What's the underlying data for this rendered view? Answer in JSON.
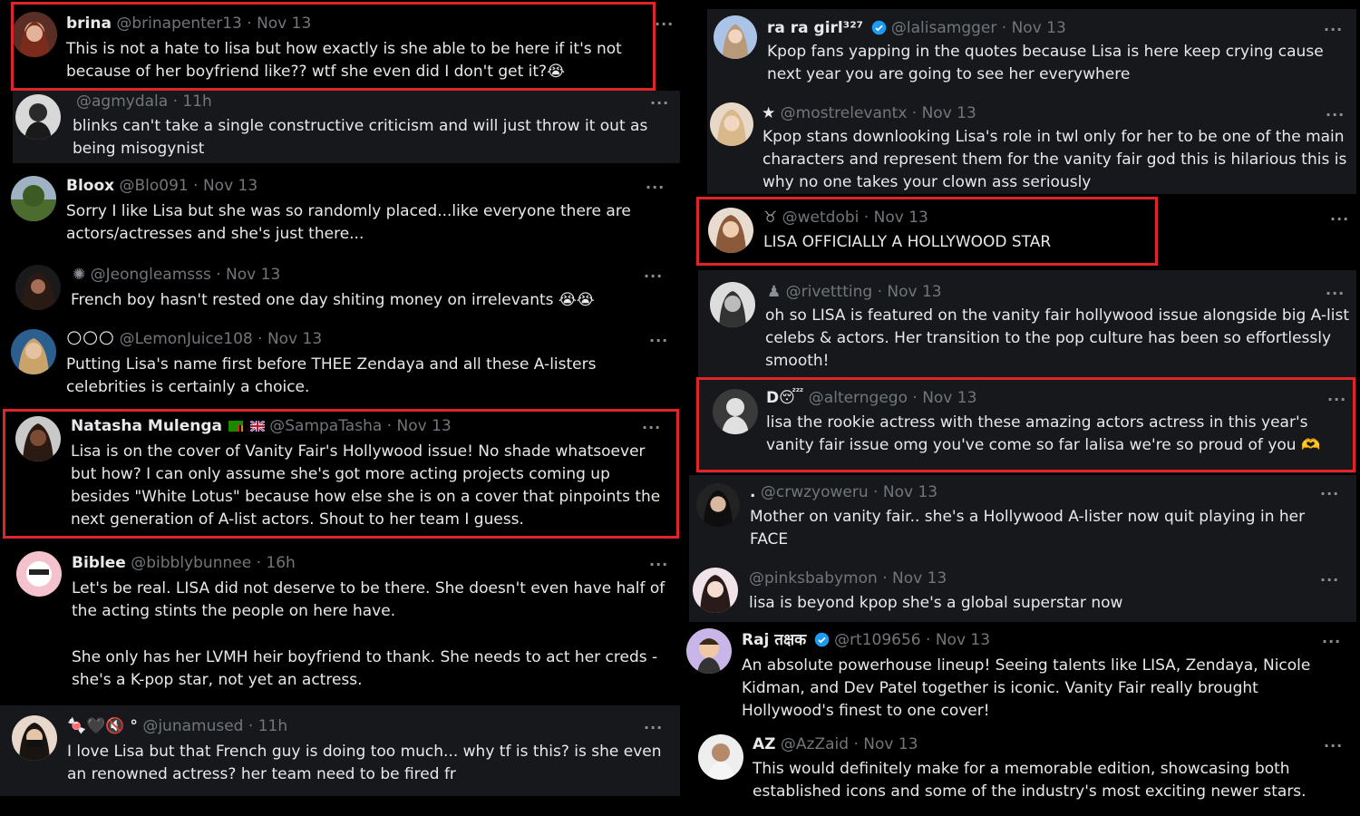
{
  "left": [
    {
      "name": "brina",
      "handle": "@brinapenter13",
      "time": "Nov 13",
      "text": "This is not a hate to lisa but how exactly is she able to be here if it's not because of her boyfriend like?? wtf she even did I don't get it?😭"
    },
    {
      "name": "",
      "handle": "@agmydala",
      "time": "11h",
      "text": "blinks can't take a single constructive criticism and will just throw it out as being misogynist"
    },
    {
      "name": "Bloox",
      "handle": "@Blo091",
      "time": "Nov 13",
      "text": "Sorry I like Lisa but she was so randomly placed...like everyone there are actors/actresses and she's just there..."
    },
    {
      "name": "",
      "name_icon": "✺",
      "handle": "@Jeongleamsss",
      "time": "Nov 13",
      "text": "French boy hasn't rested one day shiting money on irrelevants 😭😭"
    },
    {
      "name": "🌕🌕🌕",
      "handle": "@LemonJuice108",
      "time": "Nov 13",
      "text": "Putting Lisa's name first before THEE Zendaya and all these A-listers celebrities is certainly a choice."
    },
    {
      "name": "Natasha Mulenga",
      "handle": "@SampaTasha",
      "time": "Nov 13",
      "text": "Lisa is on the cover of Vanity Fair's Hollywood issue! No shade whatsoever but how? I can only assume she's got more acting projects coming up besides \"White Lotus\" because how else she is on a cover that pinpoints the next generation of A-list actors. Shout to her team I guess."
    },
    {
      "name": "Biblee",
      "handle": "@bibblybunnee",
      "time": "16h",
      "text": "Let's be real. LISA did not deserve to be there. She doesn't even have half of the acting stints the people on here have.",
      "text2": "She only has her LVMH heir boyfriend to thank. She needs to act her creds - she's a K-pop star, not yet an actress."
    },
    {
      "name": "🍬🖤🔇 °",
      "handle": "@junamused",
      "time": "11h",
      "text": "I love Lisa but that French guy is doing too much... why tf is this? is she even an renowned actress? her team need to be fired fr"
    }
  ],
  "right": [
    {
      "name": "ra ra girl³²⁷",
      "handle": "@lalisamgger",
      "time": "Nov 13",
      "text": "Kpop fans yapping in the quotes because Lisa is here keep crying cause next year you are going to see her everywhere"
    },
    {
      "name": "★",
      "handle": "@mostrelevantx",
      "time": "Nov 13",
      "text": "Kpop stans downlooking Lisa's role in twl only for her to be one of the main characters and represent them for the vanity fair god this is hilarious this is why no one takes your clown ass seriously"
    },
    {
      "name": "♉",
      "handle": "@wetdobi",
      "time": "Nov 13",
      "text": "LISA OFFICIALLY A HOLLYWOOD STAR"
    },
    {
      "name": "♟",
      "handle": "@rivettting",
      "time": "Nov 13",
      "text": "oh so LISA is featured on the vanity fair hollywood issue alongside big A-list celebs & actors. Her transition to the pop culture has been so effortlessly smooth!"
    },
    {
      "name": "D😴",
      "handle": "@alterngego",
      "time": "Nov 13",
      "text": "lisa the rookie actress with these amazing actors actress in this year's vanity fair issue omg you've come so far lalisa we're so proud of you 🫶"
    },
    {
      "name": ".",
      "handle": "@crwzyoweru",
      "time": "Nov 13",
      "text": "Mother on vanity fair.. she's a Hollywood A-lister now quit playing in her FACE"
    },
    {
      "name": "",
      "handle": "@pinksbabymon",
      "time": "Nov 13",
      "text": "lisa is beyond kpop she's a global superstar now"
    },
    {
      "name": "Raj तक्षक",
      "handle": "@rt109656",
      "time": "Nov 13",
      "text": "An absolute powerhouse lineup! Seeing talents like LISA, Zendaya, Nicole Kidman, and Dev Patel together is iconic. Vanity Fair really brought Hollywood's finest to one cover!"
    },
    {
      "name": "AZ",
      "handle": "@AzZaid",
      "time": "Nov 13",
      "text": "This would definitely make for a memorable edition, showcasing both established icons and some of the industry's most exciting newer stars."
    }
  ],
  "more_label": "···",
  "dot": "·",
  "colors": {
    "bg": "#000000",
    "card": "#16181c",
    "text": "#e7e9ea",
    "muted": "#71767b",
    "highlight": "#e0252a",
    "verified": "#1d9bf0"
  }
}
